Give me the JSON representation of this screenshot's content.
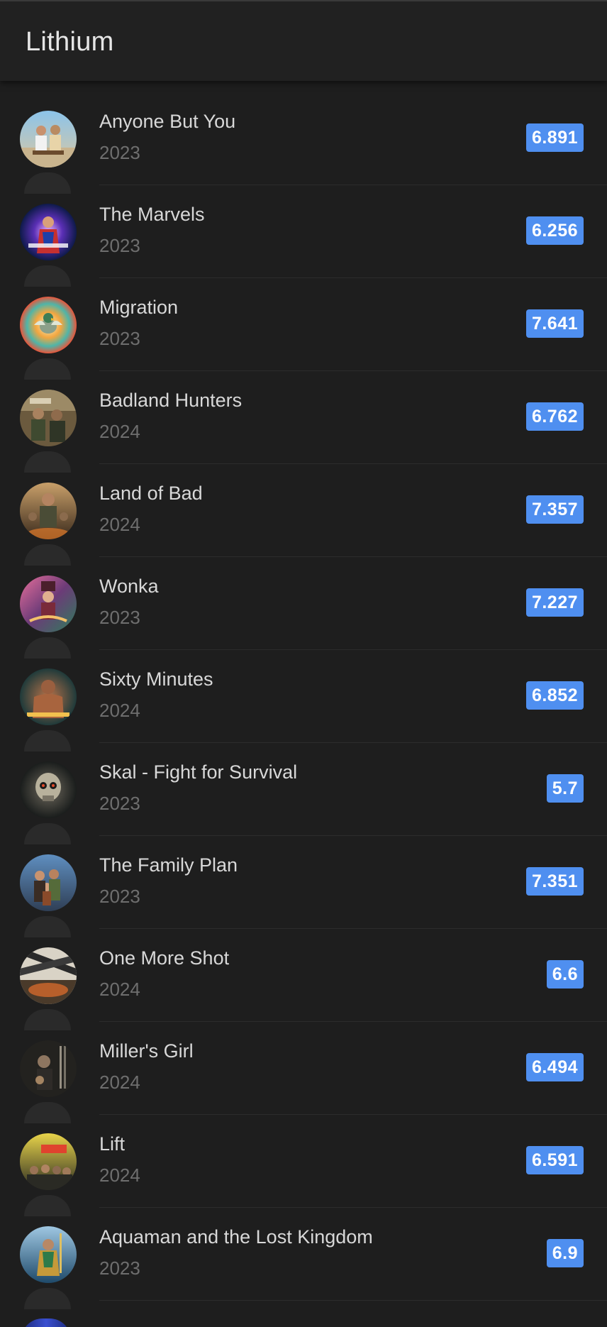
{
  "app": {
    "title": "Lithium"
  },
  "colors": {
    "background": "#1e1e1e",
    "toolbar": "#212121",
    "rating_badge": "#4f8ff0",
    "title_text": "#d8d8d8",
    "year_text": "#6e6e6e"
  },
  "movies": [
    {
      "title": "Anyone But You",
      "year": "2023",
      "rating": "6.891",
      "poster": "poster-couple-beach"
    },
    {
      "title": "The Marvels",
      "year": "2023",
      "rating": "6.256",
      "poster": "poster-the-marvels"
    },
    {
      "title": "Migration",
      "year": "2023",
      "rating": "7.641",
      "poster": "poster-duck-colorful"
    },
    {
      "title": "Badland Hunters",
      "year": "2024",
      "rating": "6.762",
      "poster": "poster-soldiers-desert"
    },
    {
      "title": "Land of Bad",
      "year": "2024",
      "rating": "7.357",
      "poster": "poster-soldiers-explosion"
    },
    {
      "title": "Wonka",
      "year": "2023",
      "rating": "7.227",
      "poster": "poster-wonka"
    },
    {
      "title": "Sixty Minutes",
      "year": "2024",
      "rating": "6.852",
      "poster": "poster-fighter"
    },
    {
      "title": "Skal - Fight for Survival",
      "year": "2023",
      "rating": "5.7",
      "poster": "poster-skull"
    },
    {
      "title": "The Family Plan",
      "year": "2023",
      "rating": "7.351",
      "poster": "poster-family"
    },
    {
      "title": "One More Shot",
      "year": "2024",
      "rating": "6.6",
      "poster": "poster-action-shot"
    },
    {
      "title": "Miller's Girl",
      "year": "2024",
      "rating": "6.494",
      "poster": "poster-millers-girl"
    },
    {
      "title": "Lift",
      "year": "2024",
      "rating": "6.591",
      "poster": "poster-lift"
    },
    {
      "title": "Aquaman and the Lost Kingdom",
      "year": "2023",
      "rating": "6.9",
      "poster": "poster-aquaman"
    }
  ]
}
